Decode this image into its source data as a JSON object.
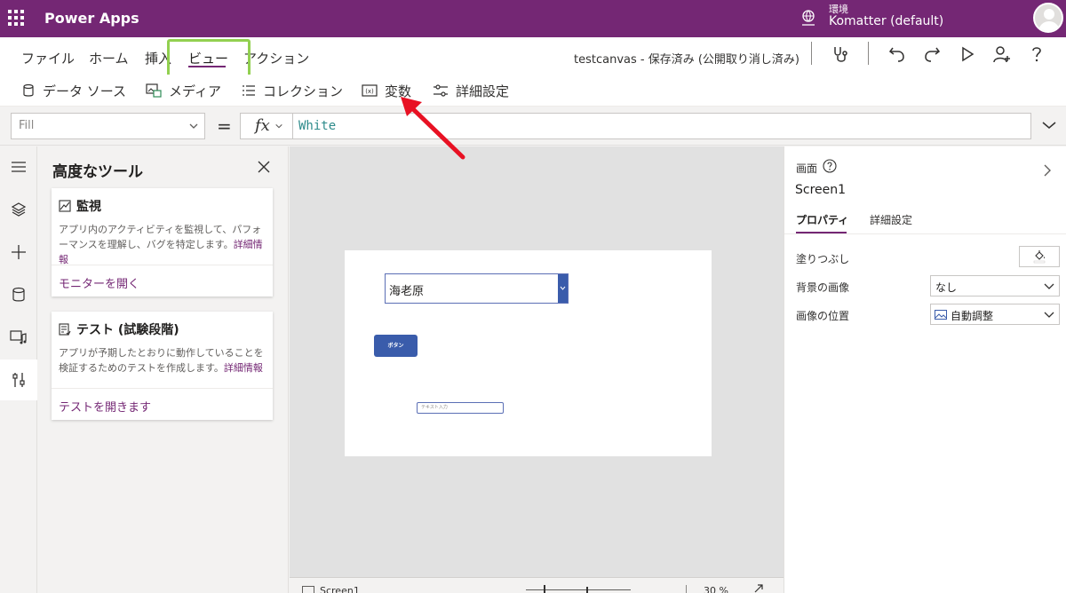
{
  "app": {
    "title": "Power Apps"
  },
  "environment": {
    "label": "環境",
    "name": "Komatter (default)"
  },
  "menu": {
    "items": [
      "ファイル",
      "ホーム",
      "挿入",
      "ビュー",
      "アクション"
    ],
    "doc_status": "testcanvas - 保存済み (公開取り消し済み)"
  },
  "ribbon": {
    "items": [
      "データ ソース",
      "メディア",
      "コレクション",
      "変数",
      "詳細設定"
    ]
  },
  "formula": {
    "property": "Fill",
    "equals": "=",
    "fx": "fx",
    "value": "White"
  },
  "advanced_tools": {
    "title": "高度なツール",
    "monitor": {
      "title": "監視",
      "description": "アプリ内のアクティビティを監視して、パフォーマンスを理解し、バグを特定します。",
      "link": "詳細情報",
      "action": "モニターを開く"
    },
    "test": {
      "title": "テスト (試験段階)",
      "description": "アプリが予期したとおりに動作していることを検証するためのテストを作成します。",
      "link": "詳細情報",
      "action": "テストを開きます"
    }
  },
  "canvas": {
    "dropdown_value": "海老原",
    "button_label": "ボタン",
    "text_input_placeholder": "テキスト入力",
    "footer_screen": "Screen1",
    "footer_zoom": "30 %"
  },
  "properties": {
    "kind": "画面",
    "name": "Screen1",
    "tabs": [
      "プロパティ",
      "詳細設定"
    ],
    "rows": {
      "fill_label": "塗りつぶし",
      "bg_image_label": "背景の画像",
      "bg_image_value": "なし",
      "image_position_label": "画像の位置",
      "image_position_value": "自動調整"
    }
  },
  "colors": {
    "brand": "#742774",
    "highlight": "#92d050",
    "arrow": "#e81123",
    "control_blue": "#3a5cab"
  }
}
